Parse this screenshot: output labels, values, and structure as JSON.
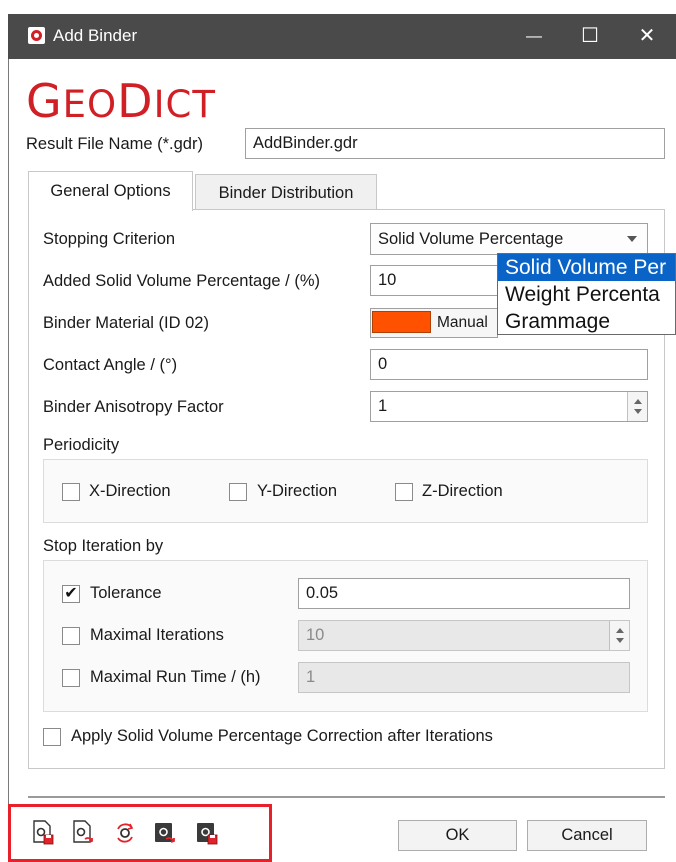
{
  "window": {
    "title": "Add Binder",
    "minimize": "—",
    "maximize": "☐",
    "close": "✕"
  },
  "logo": {
    "text_geo_g": "G",
    "text_geo_rest": "EO",
    "text_dict_d": "D",
    "text_dict_rest": "ICT"
  },
  "result_file": {
    "label": "Result File Name (*.gdr)",
    "value": "AddBinder.gdr"
  },
  "tabs": [
    {
      "label": "General Options",
      "active": true
    },
    {
      "label": "Binder Distribution",
      "active": false
    }
  ],
  "general": {
    "stopping_criterion": {
      "label": "Stopping Criterion",
      "value": "Solid Volume Percentage"
    },
    "dropdown_options": [
      "Solid Volume Per",
      "Weight Percenta",
      "Grammage"
    ],
    "added_svp": {
      "label": "Added Solid Volume Percentage / (%)",
      "value": "10"
    },
    "binder_material": {
      "label": "Binder Material (ID 02)",
      "value": "Manual",
      "color": "#ff5100"
    },
    "contact_angle": {
      "label": "Contact Angle / (°)",
      "value": "0"
    },
    "anisotropy": {
      "label": "Binder Anisotropy Factor",
      "value": "1"
    },
    "periodicity": {
      "label": "Periodicity",
      "x": {
        "label": "X-Direction",
        "checked": false
      },
      "y": {
        "label": "Y-Direction",
        "checked": false
      },
      "z": {
        "label": "Z-Direction",
        "checked": false
      }
    },
    "stop_iteration": {
      "label": "Stop Iteration by",
      "tolerance": {
        "label": "Tolerance",
        "checked": true,
        "value": "0.05",
        "mark": "✔"
      },
      "max_iterations": {
        "label": "Maximal Iterations",
        "checked": false,
        "value": "10"
      },
      "max_runtime": {
        "label": "Maximal Run Time / (h)",
        "checked": false,
        "value": "1"
      }
    },
    "apply_correction": {
      "label": "Apply Solid Volume Percentage Correction after Iterations",
      "checked": false
    }
  },
  "footer": {
    "icons": [
      "save-settings-icon",
      "load-settings-icon",
      "reset-settings-icon",
      "run-macro-icon",
      "record-macro-icon"
    ],
    "ok_label": "OK",
    "cancel_label": "Cancel",
    "highlight_color": "#e8202a"
  }
}
